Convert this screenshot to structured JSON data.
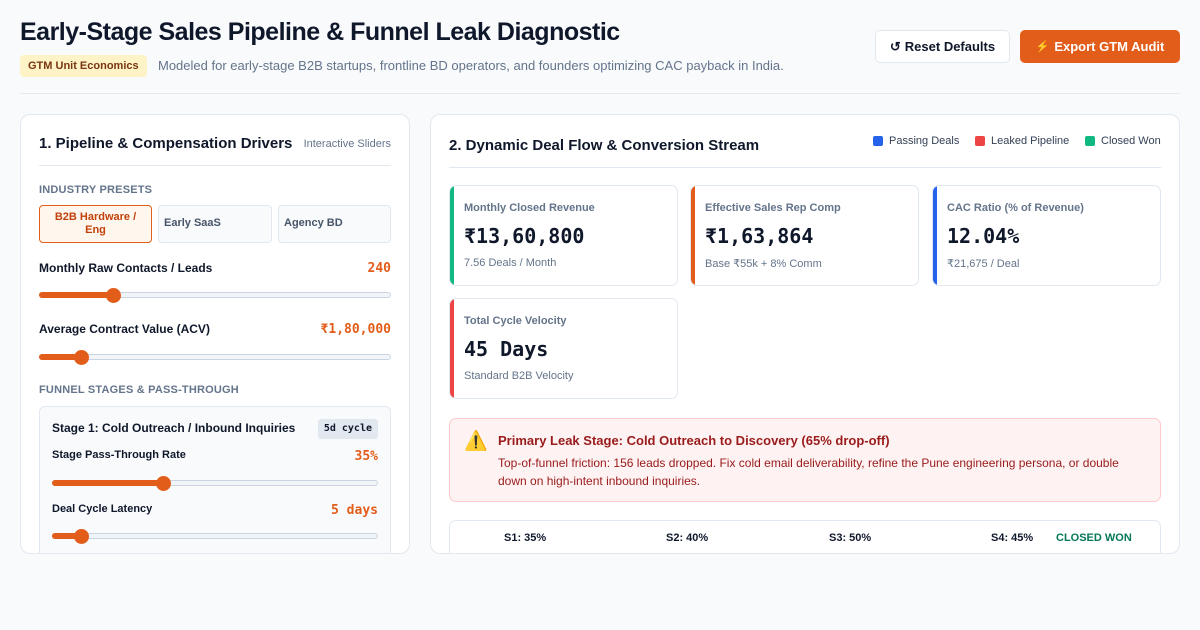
{
  "header": {
    "title": "Early-Stage Sales Pipeline & Funnel Leak Diagnostic",
    "badge": "GTM Unit Economics",
    "subtitle": "Modeled for early-stage B2B startups, frontline BD operators, and founders optimizing CAC payback in India.",
    "reset_icon": "↺",
    "reset_label": "Reset Defaults",
    "export_icon": "⚡",
    "export_label": "Export GTM Audit"
  },
  "left": {
    "title": "1. Pipeline & Compensation Drivers",
    "hint": "Interactive Sliders",
    "presets_label": "INDUSTRY PRESETS",
    "presets": [
      {
        "label": "B2B Hardware / Eng",
        "active": true
      },
      {
        "label": "Early SaaS",
        "active": false
      },
      {
        "label": "Agency BD",
        "active": false
      }
    ],
    "leads": {
      "label": "Monthly Raw Contacts / Leads",
      "value": "240",
      "level": 0.21
    },
    "acv": {
      "label": "Average Contract Value (ACV)",
      "value": "₹1,80,000",
      "level": 0.12
    },
    "funnel_label": "FUNNEL STAGES & PASS-THROUGH",
    "stage1": {
      "title": "Stage 1: Cold Outreach / Inbound Inquiries",
      "cycle": "5d cycle",
      "pass_label": "Stage Pass-Through Rate",
      "pass_value": "35%",
      "pass_level": 0.34,
      "latency_label": "Deal Cycle Latency",
      "latency_value": "5 days",
      "latency_level": 0.09
    }
  },
  "right": {
    "title": "2. Dynamic Deal Flow & Conversion Stream",
    "legend": [
      {
        "label": "Passing Deals",
        "color": "#2563eb"
      },
      {
        "label": "Leaked Pipeline",
        "color": "#ef4444"
      },
      {
        "label": "Closed Won",
        "color": "#10b981"
      }
    ],
    "kpis": [
      {
        "label": "Monthly Closed Revenue",
        "value": "₹13,60,800",
        "sub": "7.56 Deals / Month",
        "color": "#10b981"
      },
      {
        "label": "Effective Sales Rep Comp",
        "value": "₹1,63,864",
        "sub": "Base ₹55k + 8% Comm",
        "color": "#e35d1a"
      },
      {
        "label": "CAC Ratio (% of Revenue)",
        "value": "12.04%",
        "sub": "₹21,675 / Deal",
        "color": "#2563eb"
      },
      {
        "label": "Total Cycle Velocity",
        "value": "45 Days",
        "sub": "Standard B2B Velocity",
        "color": "#ef4444"
      }
    ],
    "alert": {
      "icon": "⚠️",
      "title": "Primary Leak Stage: Cold Outreach to Discovery (65% drop-off)",
      "body": "Top-of-funnel friction: 156 leads dropped. Fix cold email deliverability, refine the Pune engineering persona, or double down on high-intent inbound inquiries."
    },
    "flow": {
      "stages": [
        "S1: 35%",
        "S2: 40%",
        "S3: 50%",
        "S4: 45%"
      ],
      "closed": "CLOSED WON"
    }
  }
}
